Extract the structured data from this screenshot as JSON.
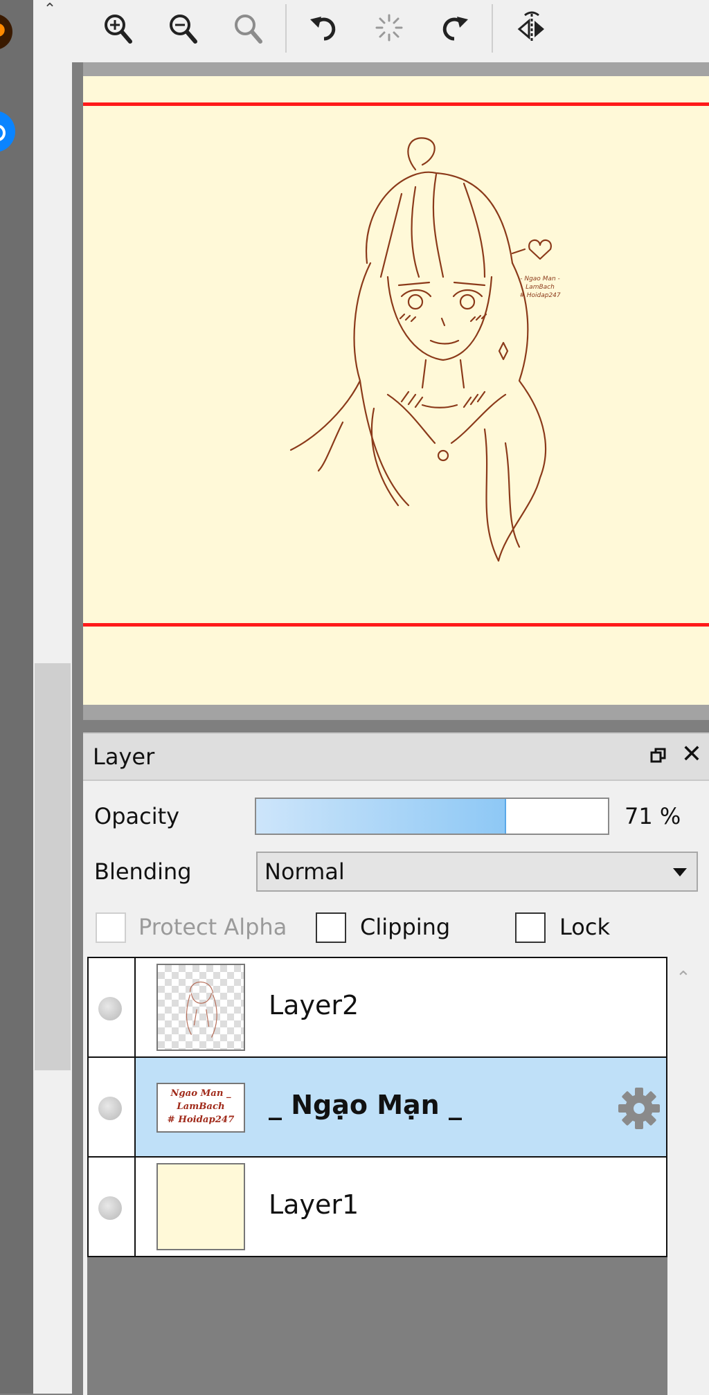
{
  "toolbar": {
    "icons": [
      "zoom-in-icon",
      "zoom-out-icon",
      "zoom-reset-icon",
      "rotate-left-icon",
      "rotate-reset-icon",
      "rotate-right-icon",
      "flip-horizontal-icon"
    ]
  },
  "canvas": {
    "background": "#fff9d8",
    "guide_color": "#ff1a1a",
    "line_art_color": "#8b3a1a",
    "signature": "Ngao Man _ LamBach # Hoidap247"
  },
  "layer_panel": {
    "title": "Layer",
    "opacity_label": "Opacity",
    "opacity_value": "71 %",
    "opacity_fraction": 0.71,
    "blending_label": "Blending",
    "blending_value": "Normal",
    "protect_alpha_label": "Protect Alpha",
    "clipping_label": "Clipping",
    "lock_label": "Lock",
    "layers": [
      {
        "name": "Layer2",
        "selected": false
      },
      {
        "name": "_ Ngạo Mạn _",
        "selected": true
      },
      {
        "name": "Layer1",
        "selected": false
      }
    ]
  }
}
